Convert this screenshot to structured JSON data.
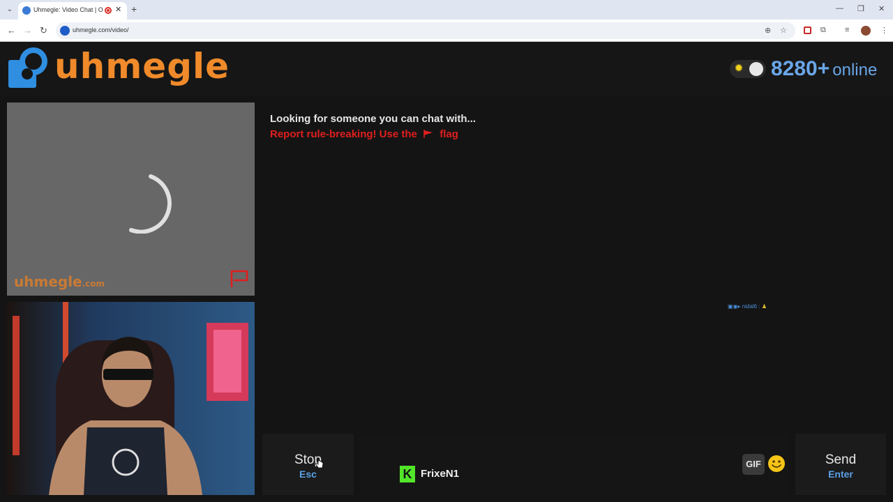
{
  "browser": {
    "tab_title": "Uhmegle: Video Chat | Omegle",
    "url": "uhmegle.com/video/",
    "tab_close": "✕",
    "new_tab": "+"
  },
  "header": {
    "logo_text": "uhmegle",
    "online_count": "8280+",
    "online_label": "online",
    "theme_icon": "sun-icon"
  },
  "stranger": {
    "watermark": "uhmegle",
    "watermark_domain": ".com"
  },
  "chat": {
    "status": "Looking for someone you can chat with...",
    "report_prefix": "Report rule-breaking! Use the",
    "report_suffix": "flag",
    "overlay_tag": "nidal6 : "
  },
  "controls": {
    "stop_label": "Stop",
    "stop_key": "Esc",
    "send_label": "Send",
    "send_key": "Enter",
    "gif_label": "GIF",
    "streamer_name": "FrixeN1",
    "streamer_icon": "K"
  },
  "colors": {
    "brand_orange": "#f08a2a",
    "brand_blue": "#2f8ee0",
    "report_red": "#e01e1e",
    "key_blue": "#5aa0e6"
  }
}
